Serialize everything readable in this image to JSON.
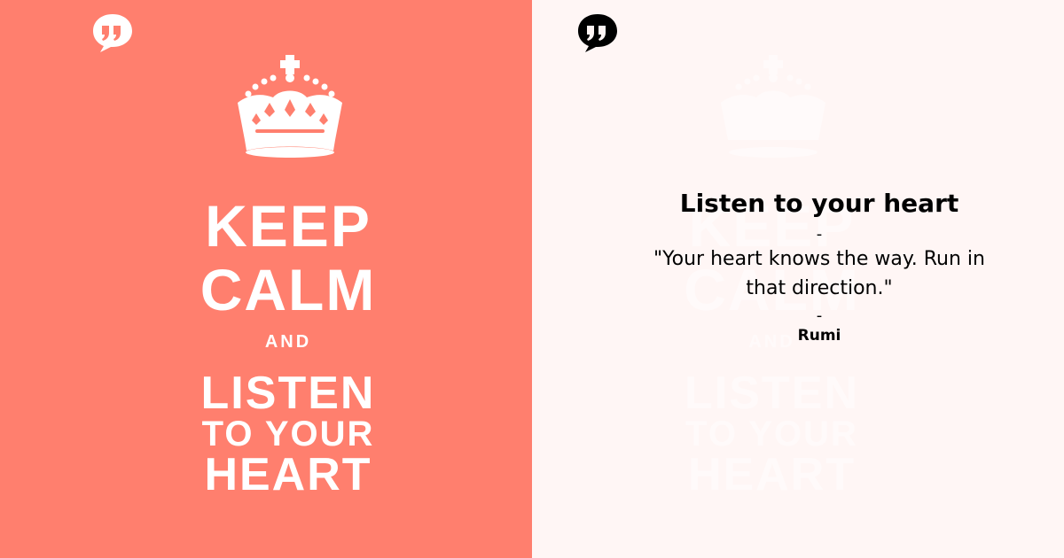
{
  "left_poster": {
    "lines": {
      "keep": "KEEP",
      "calm": "CALM",
      "and": "AND",
      "listen": "LISTEN",
      "to_your": "TO YOUR",
      "heart": "HEART"
    }
  },
  "quote": {
    "title": "Listen to your heart",
    "separator": "-",
    "text": "\"Your heart knows the way. Run in that direction.\"",
    "author": "Rumi"
  },
  "icons": {
    "logo": "quote-bubble-icon",
    "crown": "crown-icon"
  },
  "colors": {
    "left_background": "#FF7F6E",
    "right_background": "#FFF6F5",
    "left_logo": "#FFFFFF",
    "right_logo": "#000000",
    "poster_text": "#FFFFFF"
  }
}
